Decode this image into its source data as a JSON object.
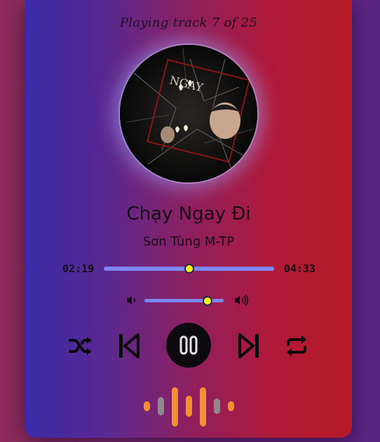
{
  "player": {
    "track_info": "Playing track 7 of 25",
    "title": "Chạy Ngay Đi",
    "artist": "Sơn Tùng M-TP",
    "current_time": "02:19",
    "duration": "04:33",
    "progress": 0.5,
    "volume": 0.8
  },
  "icons": {
    "volume_low": "speaker-low-icon",
    "volume_high": "speaker-high-icon",
    "shuffle": "shuffle-icon",
    "previous": "skip-previous-icon",
    "pause": "pause-icon",
    "next": "skip-next-icon",
    "repeat": "repeat-icon"
  },
  "colors": {
    "accent": "#7d87f2",
    "knob": "#fff11b",
    "wave_orange": "#f3902a",
    "wave_gray": "#8b8b8b"
  }
}
